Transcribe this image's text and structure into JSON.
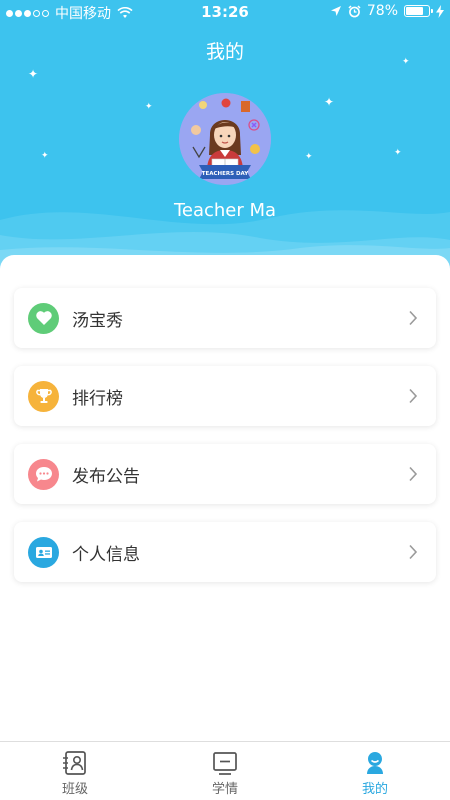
{
  "status_bar": {
    "carrier": "中国移动",
    "time": "13:26",
    "battery_percent": "78%",
    "battery_level": 0.78,
    "signal_dots_filled": 3,
    "signal_dots_total": 5
  },
  "header": {
    "title": "我的",
    "user_name": "Teacher Ma",
    "avatar_badge": "TEACHERS DAY"
  },
  "menu": [
    {
      "label": "汤宝秀",
      "icon": "heart-icon",
      "color": "#5fcc78"
    },
    {
      "label": "排行榜",
      "icon": "trophy-icon",
      "color": "#f6b33b"
    },
    {
      "label": "发布公告",
      "icon": "chat-bubble-icon",
      "color": "#f7878d"
    },
    {
      "label": "个人信息",
      "icon": "id-card-icon",
      "color": "#2aa8e0"
    }
  ],
  "tabbar": {
    "tabs": [
      {
        "label": "班级",
        "icon": "class-roster-icon",
        "active": false
      },
      {
        "label": "学情",
        "icon": "learning-stats-icon",
        "active": false
      },
      {
        "label": "我的",
        "icon": "profile-icon",
        "active": true
      }
    ]
  },
  "colors": {
    "header_bg": "#3dc3ee",
    "accent": "#2aa8e0"
  }
}
